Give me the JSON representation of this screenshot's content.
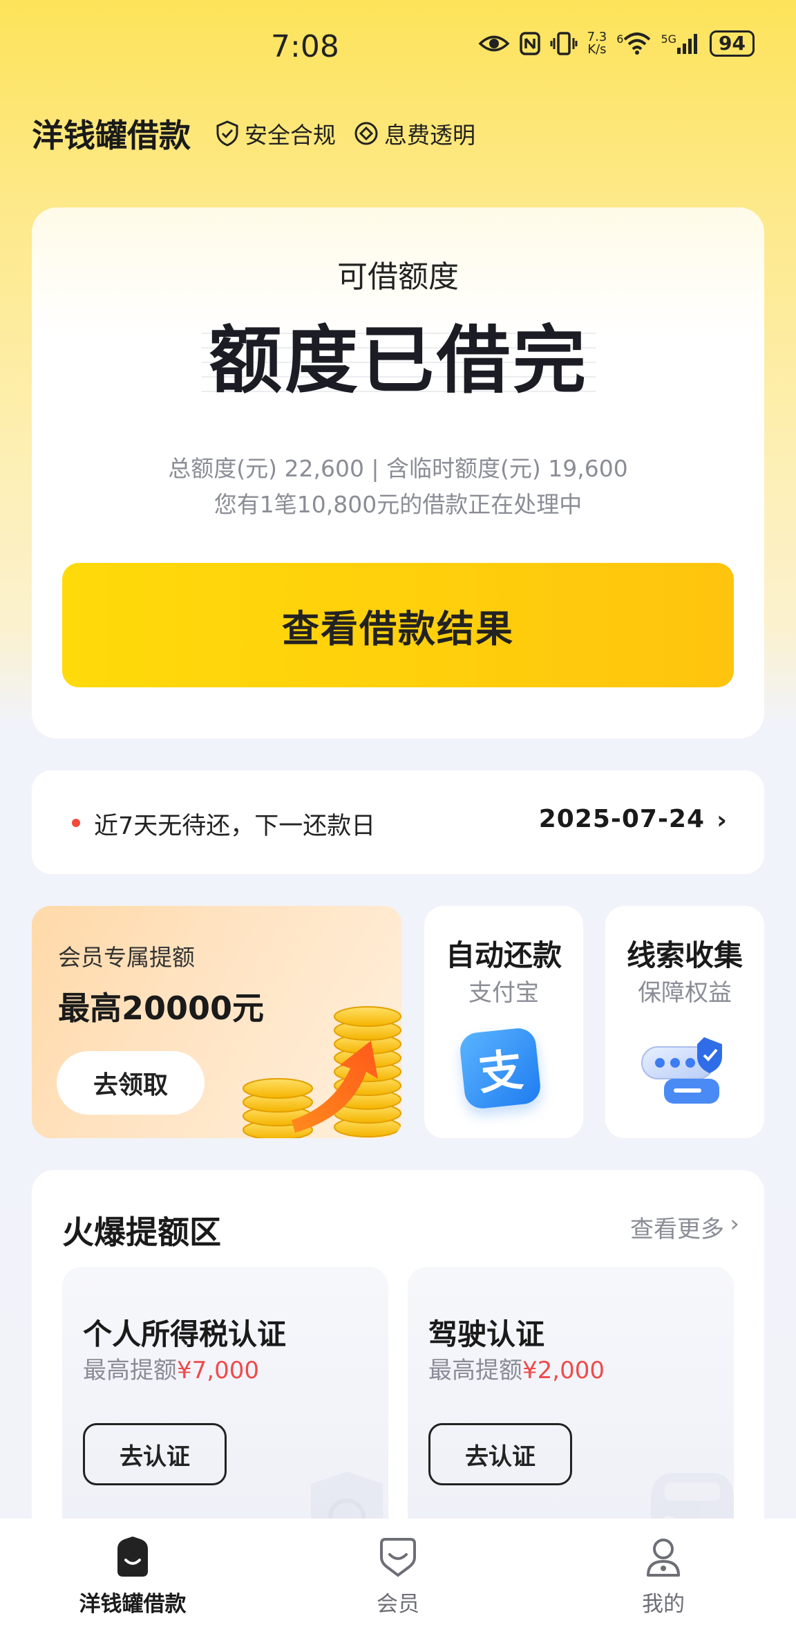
{
  "status_bar": {
    "time": "7:08",
    "net_speed_value": "7.3",
    "net_speed_unit": "K/s",
    "sim_label": "6",
    "network_label": "5G",
    "battery": "94"
  },
  "header": {
    "app_title": "洋钱罐借款",
    "tags": [
      {
        "label": "安全合规",
        "icon": "shield-check-icon"
      },
      {
        "label": "息费透明",
        "icon": "diamond-icon"
      }
    ]
  },
  "quota": {
    "label": "可借额度",
    "status": "额度已借完",
    "total_line": "总额度(元) 22,600 | 含临时额度(元) 19,600",
    "processing_line": "您有1笔10,800元的借款正在处理中",
    "cta_label": "查看借款结果"
  },
  "repayment": {
    "text": "近7天无待还，下一还款日",
    "date": "2025-07-24",
    "chevron": "›"
  },
  "member_promo": {
    "subtitle": "会员专属提额",
    "title": "最高20000元",
    "button_label": "去领取"
  },
  "features": [
    {
      "title": "自动还款",
      "subtitle": "支付宝",
      "icon": "alipay-icon",
      "icon_glyph": "支"
    },
    {
      "title": "线索收集",
      "subtitle": "保障权益",
      "icon": "chat-shield-icon"
    }
  ],
  "hot_section": {
    "title": "火爆提额区",
    "more_label": "查看更多",
    "items": [
      {
        "title": "个人所得税认证",
        "sub_prefix": "最高提额",
        "amount": "¥7,000",
        "button_label": "去认证"
      },
      {
        "title": "驾驶认证",
        "sub_prefix": "最高提额",
        "amount": "¥2,000",
        "button_label": "去认证"
      }
    ]
  },
  "bottom_nav": {
    "items": [
      {
        "label": "洋钱罐借款",
        "icon": "home-bag-icon",
        "active": true
      },
      {
        "label": "会员",
        "icon": "member-badge-icon",
        "active": false
      },
      {
        "label": "我的",
        "icon": "profile-icon",
        "active": false
      }
    ]
  },
  "colors": {
    "accent_yellow": "#ffd20c",
    "highlight_red": "#ef4a4a",
    "dot_red": "#f04b3c"
  }
}
